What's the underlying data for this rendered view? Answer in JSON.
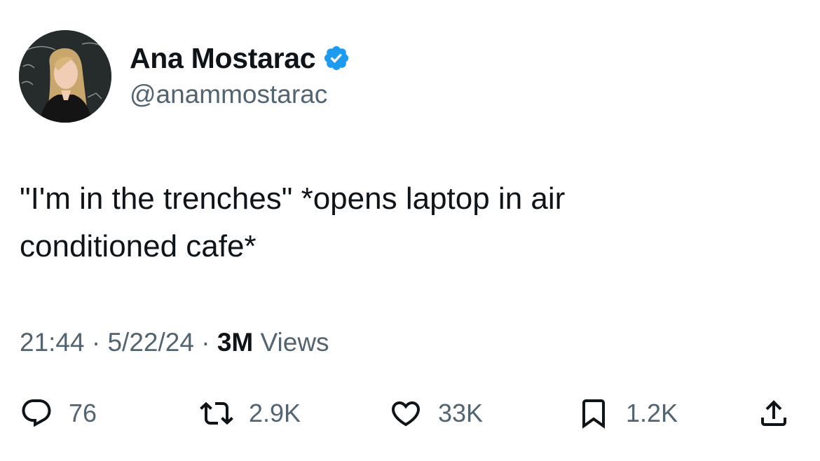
{
  "author": {
    "display_name": "Ana Mostarac",
    "handle": "@anammostarac",
    "verified_icon": "verified-badge-icon",
    "verified_color": "#1d9bf0"
  },
  "tweet": {
    "text": "\"I'm in the trenches\" *opens laptop in air conditioned cafe*"
  },
  "meta": {
    "time": "21:44",
    "separator_1": "·",
    "date": "5/22/24",
    "separator_2": "·",
    "views_count": "3M",
    "views_label": "Views"
  },
  "actions": {
    "reply": {
      "icon": "reply-icon",
      "count": "76"
    },
    "retweet": {
      "icon": "retweet-icon",
      "count": "2.9K"
    },
    "like": {
      "icon": "heart-icon",
      "count": "33K"
    },
    "bookmark": {
      "icon": "bookmark-icon",
      "count": "1.2K"
    },
    "share": {
      "icon": "share-icon"
    }
  },
  "colors": {
    "text_primary": "#0f1419",
    "text_secondary": "#536471",
    "background": "#ffffff"
  }
}
